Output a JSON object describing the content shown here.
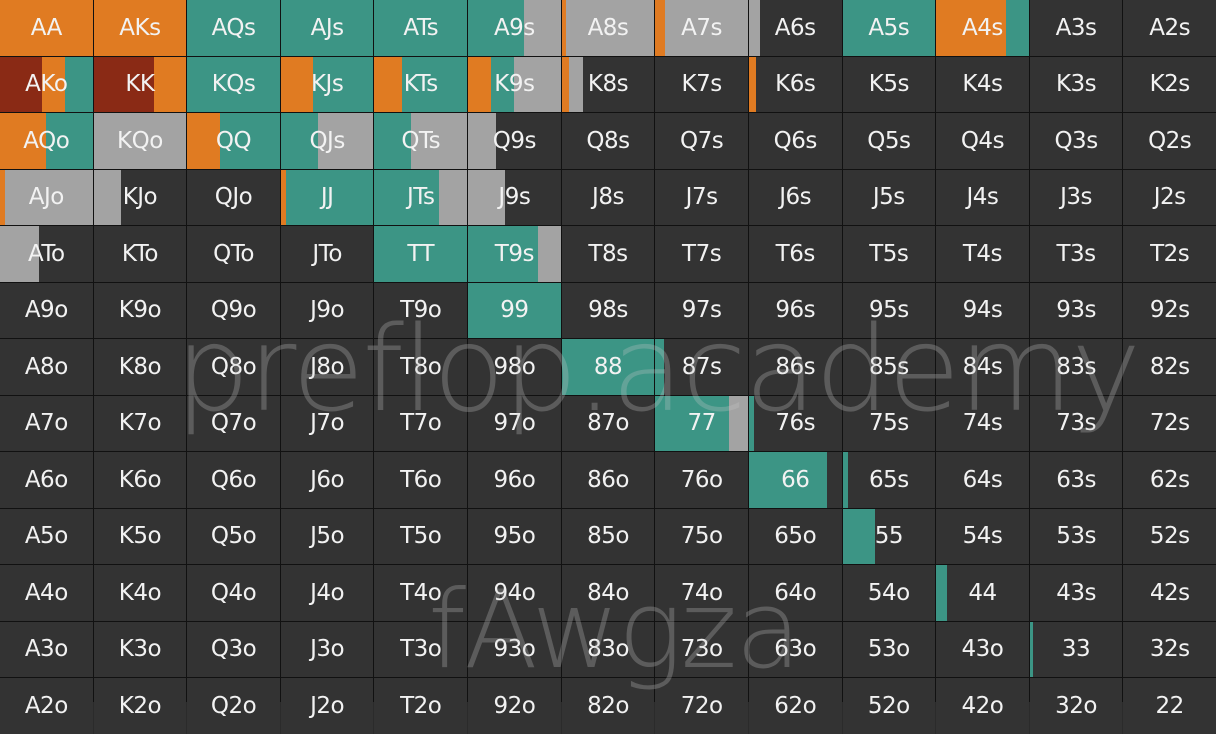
{
  "watermark_site": "preflop.academy",
  "watermark_user": "fAwgza",
  "colors": {
    "raise": "#e07b22",
    "allin": "#8a2a15",
    "call": "#3c9585",
    "fold_gray": "#a3a3a3",
    "empty": "#333333",
    "text": "#f2f2f2"
  },
  "cells": [
    [
      {
        "h": "AA",
        "f": [
          [
            "raise",
            1
          ]
        ]
      },
      {
        "h": "AKs",
        "f": [
          [
            "raise",
            1
          ]
        ]
      },
      {
        "h": "AQs",
        "f": [
          [
            "call",
            1
          ]
        ]
      },
      {
        "h": "AJs",
        "f": [
          [
            "call",
            1
          ]
        ]
      },
      {
        "h": "ATs",
        "f": [
          [
            "call",
            1
          ]
        ]
      },
      {
        "h": "A9s",
        "f": [
          [
            "call",
            0.6
          ],
          [
            "fold_gray",
            0.4
          ]
        ]
      },
      {
        "h": "A8s",
        "f": [
          [
            "raise",
            0.05
          ],
          [
            "fold_gray",
            0.95
          ]
        ]
      },
      {
        "h": "A7s",
        "f": [
          [
            "raise",
            0.1
          ],
          [
            "fold_gray",
            0.9
          ]
        ]
      },
      {
        "h": "A6s",
        "f": [
          [
            "fold_gray",
            0.12
          ]
        ]
      },
      {
        "h": "A5s",
        "f": [
          [
            "call",
            1
          ]
        ]
      },
      {
        "h": "A4s",
        "f": [
          [
            "raise",
            0.75
          ],
          [
            "call",
            0.25
          ]
        ]
      },
      {
        "h": "A3s",
        "f": []
      },
      {
        "h": "A2s",
        "f": []
      }
    ],
    [
      {
        "h": "AKo",
        "f": [
          [
            "allin",
            0.45
          ],
          [
            "raise",
            0.25
          ],
          [
            "call",
            0.3
          ]
        ]
      },
      {
        "h": "KK",
        "f": [
          [
            "allin",
            0.65
          ],
          [
            "raise",
            0.35
          ]
        ]
      },
      {
        "h": "KQs",
        "f": [
          [
            "call",
            1
          ]
        ]
      },
      {
        "h": "KJs",
        "f": [
          [
            "raise",
            0.35
          ],
          [
            "call",
            0.65
          ]
        ]
      },
      {
        "h": "KTs",
        "f": [
          [
            "raise",
            0.3
          ],
          [
            "call",
            0.7
          ]
        ]
      },
      {
        "h": "K9s",
        "f": [
          [
            "raise",
            0.25
          ],
          [
            "call",
            0.25
          ],
          [
            "fold_gray",
            0.5
          ]
        ]
      },
      {
        "h": "K8s",
        "f": [
          [
            "raise",
            0.08
          ],
          [
            "fold_gray",
            0.15
          ]
        ]
      },
      {
        "h": "K7s",
        "f": []
      },
      {
        "h": "K6s",
        "f": [
          [
            "raise",
            0.08
          ]
        ]
      },
      {
        "h": "K5s",
        "f": []
      },
      {
        "h": "K4s",
        "f": []
      },
      {
        "h": "K3s",
        "f": []
      },
      {
        "h": "K2s",
        "f": []
      }
    ],
    [
      {
        "h": "AQo",
        "f": [
          [
            "raise",
            0.5
          ],
          [
            "call",
            0.5
          ]
        ]
      },
      {
        "h": "KQo",
        "f": [
          [
            "fold_gray",
            1
          ]
        ]
      },
      {
        "h": "QQ",
        "f": [
          [
            "raise",
            0.35
          ],
          [
            "call",
            0.65
          ]
        ]
      },
      {
        "h": "QJs",
        "f": [
          [
            "call",
            0.4
          ],
          [
            "fold_gray",
            0.6
          ]
        ]
      },
      {
        "h": "QTs",
        "f": [
          [
            "call",
            0.4
          ],
          [
            "fold_gray",
            0.6
          ]
        ]
      },
      {
        "h": "Q9s",
        "f": [
          [
            "fold_gray",
            0.3
          ]
        ]
      },
      {
        "h": "Q8s",
        "f": []
      },
      {
        "h": "Q7s",
        "f": []
      },
      {
        "h": "Q6s",
        "f": []
      },
      {
        "h": "Q5s",
        "f": []
      },
      {
        "h": "Q4s",
        "f": []
      },
      {
        "h": "Q3s",
        "f": []
      },
      {
        "h": "Q2s",
        "f": []
      }
    ],
    [
      {
        "h": "AJo",
        "f": [
          [
            "raise",
            0.05
          ],
          [
            "fold_gray",
            0.95
          ]
        ]
      },
      {
        "h": "KJo",
        "f": [
          [
            "fold_gray",
            0.3
          ]
        ]
      },
      {
        "h": "QJo",
        "f": []
      },
      {
        "h": "JJ",
        "f": [
          [
            "raise",
            0.06
          ],
          [
            "call",
            0.94
          ]
        ]
      },
      {
        "h": "JTs",
        "f": [
          [
            "call",
            0.7
          ],
          [
            "fold_gray",
            0.3
          ]
        ]
      },
      {
        "h": "J9s",
        "f": [
          [
            "fold_gray",
            0.4
          ]
        ]
      },
      {
        "h": "J8s",
        "f": []
      },
      {
        "h": "J7s",
        "f": []
      },
      {
        "h": "J6s",
        "f": []
      },
      {
        "h": "J5s",
        "f": []
      },
      {
        "h": "J4s",
        "f": []
      },
      {
        "h": "J3s",
        "f": []
      },
      {
        "h": "J2s",
        "f": []
      }
    ],
    [
      {
        "h": "ATo",
        "f": [
          [
            "fold_gray",
            0.42
          ]
        ]
      },
      {
        "h": "KTo",
        "f": []
      },
      {
        "h": "QTo",
        "f": []
      },
      {
        "h": "JTo",
        "f": []
      },
      {
        "h": "TT",
        "f": [
          [
            "call",
            1
          ]
        ]
      },
      {
        "h": "T9s",
        "f": [
          [
            "call",
            0.75
          ],
          [
            "fold_gray",
            0.25
          ]
        ]
      },
      {
        "h": "T8s",
        "f": []
      },
      {
        "h": "T7s",
        "f": []
      },
      {
        "h": "T6s",
        "f": []
      },
      {
        "h": "T5s",
        "f": []
      },
      {
        "h": "T4s",
        "f": []
      },
      {
        "h": "T3s",
        "f": []
      },
      {
        "h": "T2s",
        "f": []
      }
    ],
    [
      {
        "h": "A9o",
        "f": []
      },
      {
        "h": "K9o",
        "f": []
      },
      {
        "h": "Q9o",
        "f": []
      },
      {
        "h": "J9o",
        "f": []
      },
      {
        "h": "T9o",
        "f": []
      },
      {
        "h": "99",
        "f": [
          [
            "call",
            1
          ]
        ]
      },
      {
        "h": "98s",
        "f": []
      },
      {
        "h": "97s",
        "f": []
      },
      {
        "h": "96s",
        "f": []
      },
      {
        "h": "95s",
        "f": []
      },
      {
        "h": "94s",
        "f": []
      },
      {
        "h": "93s",
        "f": []
      },
      {
        "h": "92s",
        "f": []
      }
    ],
    [
      {
        "h": "A8o",
        "f": []
      },
      {
        "h": "K8o",
        "f": []
      },
      {
        "h": "Q8o",
        "f": []
      },
      {
        "h": "J8o",
        "f": []
      },
      {
        "h": "T8o",
        "f": []
      },
      {
        "h": "98o",
        "f": []
      },
      {
        "h": "88",
        "f": [
          [
            "call",
            1
          ]
        ]
      },
      {
        "h": "87s",
        "f": [
          [
            "call",
            0.09
          ]
        ]
      },
      {
        "h": "86s",
        "f": []
      },
      {
        "h": "85s",
        "f": []
      },
      {
        "h": "84s",
        "f": []
      },
      {
        "h": "83s",
        "f": []
      },
      {
        "h": "82s",
        "f": []
      }
    ],
    [
      {
        "h": "A7o",
        "f": []
      },
      {
        "h": "K7o",
        "f": []
      },
      {
        "h": "Q7o",
        "f": []
      },
      {
        "h": "J7o",
        "f": []
      },
      {
        "h": "T7o",
        "f": []
      },
      {
        "h": "97o",
        "f": []
      },
      {
        "h": "87o",
        "f": []
      },
      {
        "h": "77",
        "f": [
          [
            "call",
            0.8
          ],
          [
            "fold_gray",
            0.2
          ]
        ]
      },
      {
        "h": "76s",
        "f": [
          [
            "call",
            0.06
          ]
        ]
      },
      {
        "h": "75s",
        "f": []
      },
      {
        "h": "74s",
        "f": []
      },
      {
        "h": "73s",
        "f": []
      },
      {
        "h": "72s",
        "f": []
      }
    ],
    [
      {
        "h": "A6o",
        "f": []
      },
      {
        "h": "K6o",
        "f": []
      },
      {
        "h": "Q6o",
        "f": []
      },
      {
        "h": "J6o",
        "f": []
      },
      {
        "h": "T6o",
        "f": []
      },
      {
        "h": "96o",
        "f": []
      },
      {
        "h": "86o",
        "f": []
      },
      {
        "h": "76o",
        "f": []
      },
      {
        "h": "66",
        "f": [
          [
            "call",
            0.84
          ]
        ]
      },
      {
        "h": "65s",
        "f": [
          [
            "call",
            0.06
          ]
        ]
      },
      {
        "h": "64s",
        "f": []
      },
      {
        "h": "63s",
        "f": []
      },
      {
        "h": "62s",
        "f": []
      }
    ],
    [
      {
        "h": "A5o",
        "f": []
      },
      {
        "h": "K5o",
        "f": []
      },
      {
        "h": "Q5o",
        "f": []
      },
      {
        "h": "J5o",
        "f": []
      },
      {
        "h": "T5o",
        "f": []
      },
      {
        "h": "95o",
        "f": []
      },
      {
        "h": "85o",
        "f": []
      },
      {
        "h": "75o",
        "f": []
      },
      {
        "h": "65o",
        "f": []
      },
      {
        "h": "55",
        "f": [
          [
            "call",
            0.35
          ]
        ]
      },
      {
        "h": "54s",
        "f": []
      },
      {
        "h": "53s",
        "f": []
      },
      {
        "h": "52s",
        "f": []
      }
    ],
    [
      {
        "h": "A4o",
        "f": []
      },
      {
        "h": "K4o",
        "f": []
      },
      {
        "h": "Q4o",
        "f": []
      },
      {
        "h": "J4o",
        "f": []
      },
      {
        "h": "T4o",
        "f": []
      },
      {
        "h": "94o",
        "f": []
      },
      {
        "h": "84o",
        "f": []
      },
      {
        "h": "74o",
        "f": []
      },
      {
        "h": "64o",
        "f": []
      },
      {
        "h": "54o",
        "f": []
      },
      {
        "h": "44",
        "f": [
          [
            "call",
            0.12
          ]
        ]
      },
      {
        "h": "43s",
        "f": []
      },
      {
        "h": "42s",
        "f": []
      }
    ],
    [
      {
        "h": "A3o",
        "f": []
      },
      {
        "h": "K3o",
        "f": []
      },
      {
        "h": "Q3o",
        "f": []
      },
      {
        "h": "J3o",
        "f": []
      },
      {
        "h": "T3o",
        "f": []
      },
      {
        "h": "93o",
        "f": []
      },
      {
        "h": "83o",
        "f": []
      },
      {
        "h": "73o",
        "f": []
      },
      {
        "h": "63o",
        "f": []
      },
      {
        "h": "53o",
        "f": []
      },
      {
        "h": "43o",
        "f": []
      },
      {
        "h": "33",
        "f": [
          [
            "call",
            0.03
          ]
        ]
      },
      {
        "h": "32s",
        "f": []
      }
    ],
    [
      {
        "h": "A2o",
        "f": []
      },
      {
        "h": "K2o",
        "f": []
      },
      {
        "h": "Q2o",
        "f": []
      },
      {
        "h": "J2o",
        "f": []
      },
      {
        "h": "T2o",
        "f": []
      },
      {
        "h": "92o",
        "f": []
      },
      {
        "h": "82o",
        "f": []
      },
      {
        "h": "72o",
        "f": []
      },
      {
        "h": "62o",
        "f": []
      },
      {
        "h": "52o",
        "f": []
      },
      {
        "h": "42o",
        "f": []
      },
      {
        "h": "32o",
        "f": []
      },
      {
        "h": "22",
        "f": []
      }
    ]
  ]
}
